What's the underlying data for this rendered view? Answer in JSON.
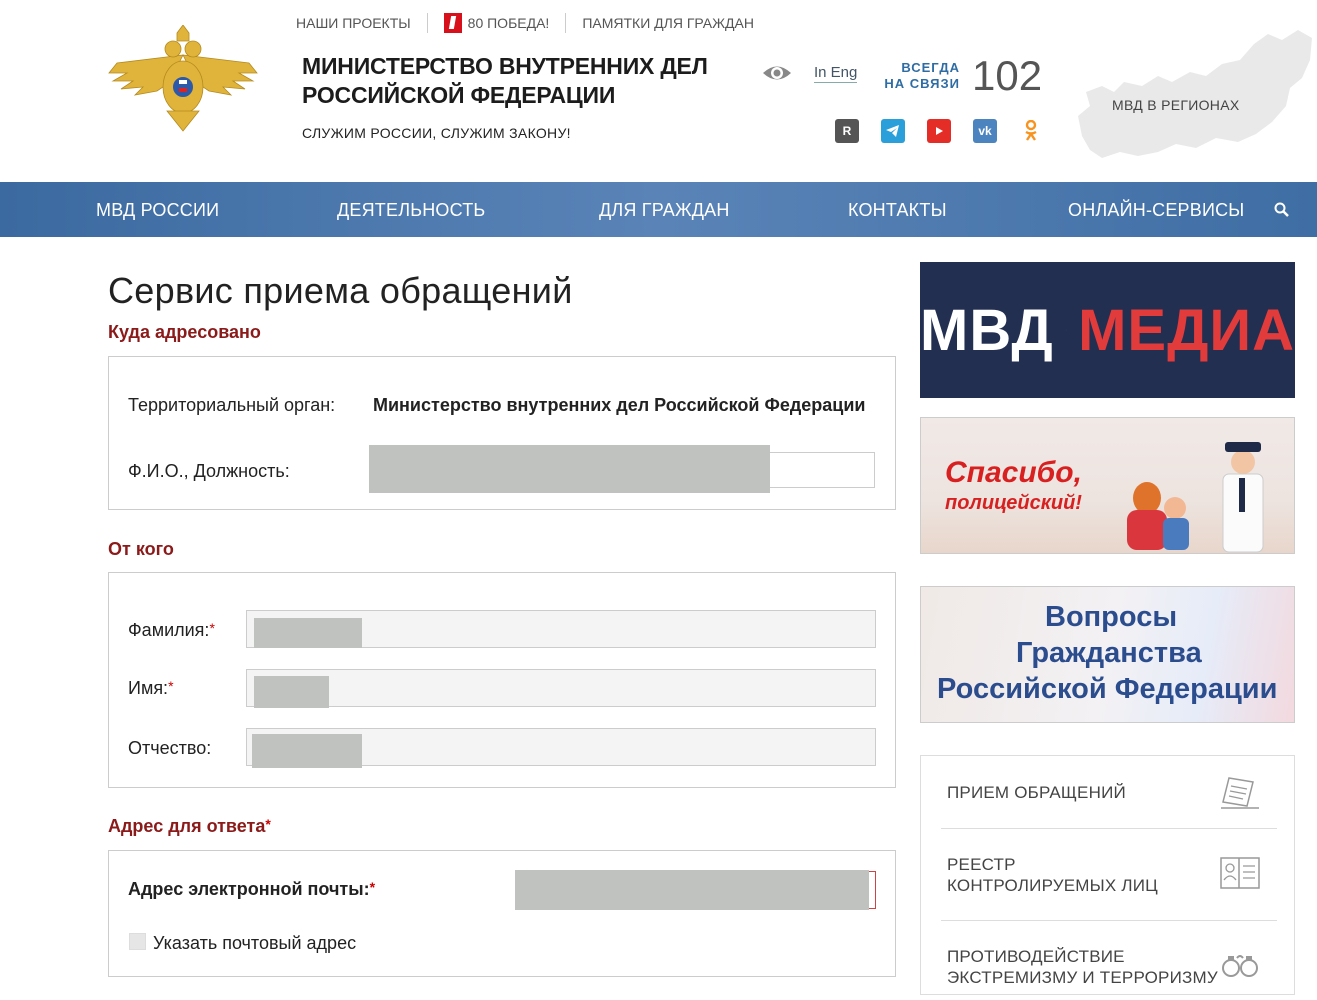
{
  "header": {
    "top_links": [
      "НАШИ ПРОЕКТЫ",
      "80 ПОБЕДА!",
      "ПАМЯТКИ ДЛЯ ГРАЖДАН"
    ],
    "title_line1": "МИНИСТЕРСТВО ВНУТРЕННИХ ДЕЛ",
    "title_line2": "РОССИЙСКОЙ ФЕДЕРАЦИИ",
    "motto": "СЛУЖИМ РОССИИ, СЛУЖИМ ЗАКОНУ!",
    "in_eng": "In Eng",
    "always_line1": "ВСЕГДА",
    "always_line2": "НА СВЯЗИ",
    "hotline": "102",
    "regions": "МВД В РЕГИОНАХ",
    "socials": [
      "rutube-icon",
      "telegram-icon",
      "youtube-icon",
      "vk-icon",
      "odnoklassniki-icon"
    ]
  },
  "nav": {
    "items": [
      "МВД РОССИИ",
      "ДЕЯТЕЛЬНОСТЬ",
      "ДЛЯ ГРАЖДАН",
      "КОНТАКТЫ",
      "ОНЛАЙН-СЕРВИСЫ"
    ]
  },
  "main": {
    "page_title": "Сервис приема обращений",
    "addressed": {
      "heading": "Куда адресовано",
      "territorial_label": "Территориальный орган:",
      "territorial_value": "Министерство внутренних дел Российской Федерации",
      "fio_label": "Ф.И.О., Должность:"
    },
    "from": {
      "heading": "От кого",
      "surname_label": "Фамилия:",
      "name_label": "Имя:",
      "patronymic_label": "Отчество:"
    },
    "reply": {
      "heading": "Адрес для ответа",
      "email_label": "Адрес электронной почты:",
      "postal_checkbox_label": "Указать почтовый адрес"
    },
    "required_mark": "*"
  },
  "sidebar": {
    "media_banner": {
      "left": "МВД",
      "right": "МЕДИА"
    },
    "thanks_banner": {
      "line1": "Спасибо,",
      "line2": "полицейский!"
    },
    "citizenship_banner": {
      "line1": "Вопросы",
      "line2": "Гражданства",
      "line3": "Российской Федерации"
    },
    "services": [
      {
        "label_line1": "ПРИЕМ ОБРАЩЕНИЙ",
        "label_line2": "",
        "icon": "document-icon"
      },
      {
        "label_line1": "РЕЕСТР",
        "label_line2": "КОНТРОЛИРУЕМЫХ ЛИЦ",
        "icon": "id-card-icon"
      },
      {
        "label_line1": "ПРОТИВОДЕЙСТВИЕ",
        "label_line2": "ЭКСТРЕМИЗМУ И ТЕРРОРИЗМУ",
        "icon": "handcuffs-icon"
      }
    ]
  },
  "colors": {
    "nav_bg": "#4a76ad",
    "section_heading": "#8b1a1a",
    "required": "#cc0000",
    "hotline_blue": "#2e6da4",
    "media_bg": "#232f50",
    "media_red": "#e23b3b"
  }
}
